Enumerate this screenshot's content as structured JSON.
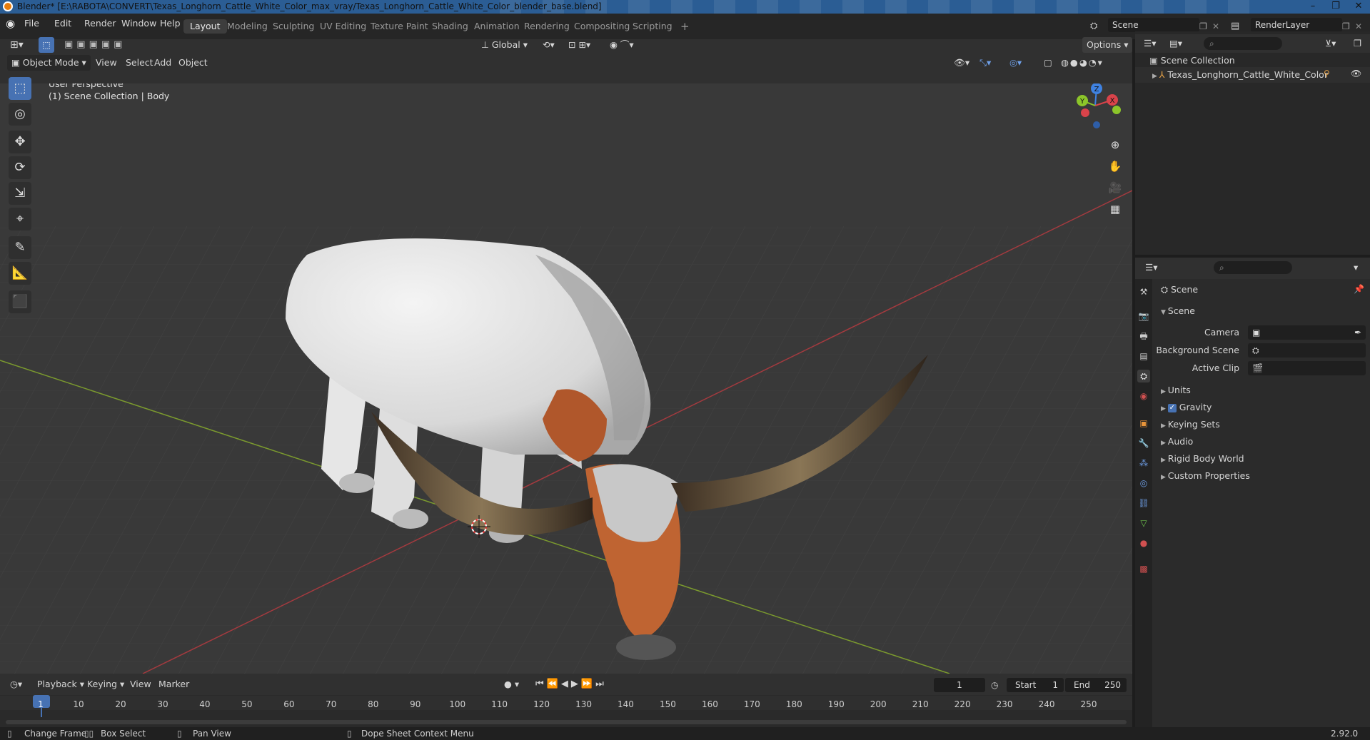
{
  "window": {
    "title": "Blender* [E:\\RABOTA\\CONVERT\\Texas_Longhorn_Cattle_White_Color_max_vray/Texas_Longhorn_Cattle_White_Color_blender_base.blend]",
    "controls": [
      "–",
      "❐",
      "✕"
    ]
  },
  "menubar": {
    "items": [
      "File",
      "Edit",
      "Render",
      "Window",
      "Help"
    ],
    "workspaces": [
      "Layout",
      "Modeling",
      "Sculpting",
      "UV Editing",
      "Texture Paint",
      "Shading",
      "Animation",
      "Rendering",
      "Compositing",
      "Scripting"
    ],
    "active_workspace": "Layout",
    "add_tab": "+",
    "scene_name": "Scene",
    "render_layer": "RenderLayer"
  },
  "viewport_header": {
    "mode": "Object Mode",
    "menus": [
      "View",
      "Select",
      "Add",
      "Object"
    ],
    "orientation": "Global",
    "options": "Options"
  },
  "viewport": {
    "overlay_title": "User Perspective",
    "overlay_subtitle": "(1) Scene Collection | Body",
    "gizmo": {
      "z": "Z",
      "y": "Y",
      "x": "X"
    },
    "colors": {
      "x_axis": "#d9434a",
      "y_axis": "#8cc52a",
      "z_axis": "#3f82e2",
      "accent": "#4772b3"
    }
  },
  "toolbar": {
    "tools": [
      "select-box",
      "cursor",
      "move",
      "rotate",
      "scale",
      "transform",
      "annotate",
      "measure",
      "add-cube"
    ]
  },
  "outliner": {
    "root": "Scene Collection",
    "items": [
      {
        "label": "Texas_Longhorn_Cattle_White_Color"
      }
    ]
  },
  "properties": {
    "context": "Scene",
    "panel_title": "Scene",
    "fields": [
      {
        "label": "Camera",
        "value": ""
      },
      {
        "label": "Background Scene",
        "value": ""
      },
      {
        "label": "Active Clip",
        "value": ""
      }
    ],
    "sections": [
      "Units",
      "Gravity",
      "Keying Sets",
      "Audio",
      "Rigid Body World",
      "Custom Properties"
    ],
    "gravity_checked": true
  },
  "timeline": {
    "menus": [
      "Playback",
      "Keying",
      "View",
      "Marker"
    ],
    "current_frame": "1",
    "start_label": "Start",
    "start_value": "1",
    "end_label": "End",
    "end_value": "250",
    "ticks": [
      "1",
      "10",
      "20",
      "30",
      "40",
      "50",
      "60",
      "70",
      "80",
      "90",
      "100",
      "110",
      "120",
      "130",
      "140",
      "150",
      "160",
      "170",
      "180",
      "190",
      "200",
      "210",
      "220",
      "230",
      "240",
      "250"
    ]
  },
  "statusbar": {
    "items": [
      "Change Frame",
      "Box Select",
      "Pan View",
      "Dope Sheet Context Menu"
    ],
    "version": "2.92.0"
  }
}
